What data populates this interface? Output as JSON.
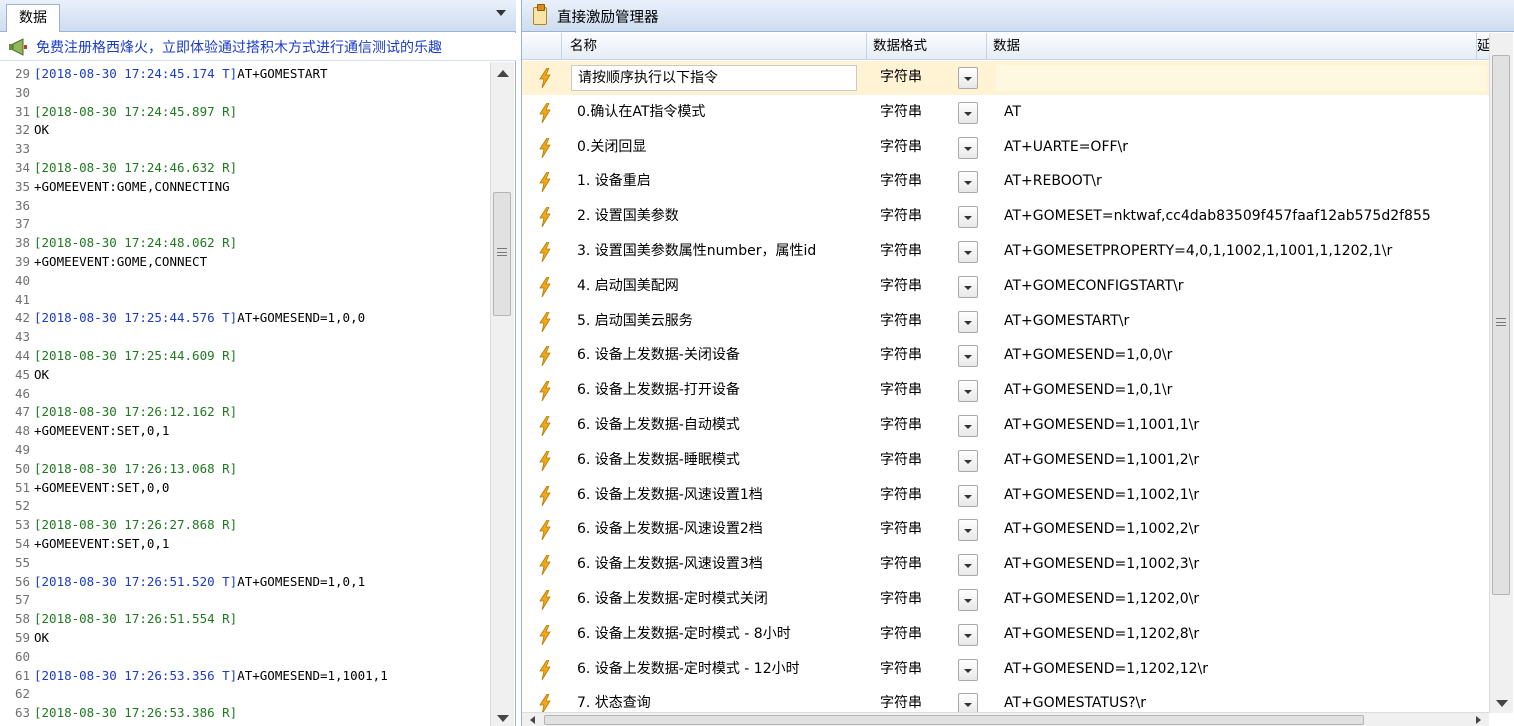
{
  "left": {
    "tab_label": "数据",
    "banner_text": "免费注册格西烽火，立即体验通过搭积木方式进行通信测试的乐趣",
    "log": [
      {
        "n": "29",
        "ts": "[2018-08-30 17:24:45.174 T]",
        "dir": "t",
        "text": "AT+GOMESTART"
      },
      {
        "n": "30",
        "ts": "",
        "dir": "",
        "text": ""
      },
      {
        "n": "31",
        "ts": "[2018-08-30 17:24:45.897 R]",
        "dir": "r",
        "text": ""
      },
      {
        "n": "32",
        "ts": "",
        "dir": "",
        "text": "OK"
      },
      {
        "n": "33",
        "ts": "",
        "dir": "",
        "text": ""
      },
      {
        "n": "34",
        "ts": "[2018-08-30 17:24:46.632 R]",
        "dir": "r",
        "text": ""
      },
      {
        "n": "35",
        "ts": "",
        "dir": "",
        "text": "+GOMEEVENT:GOME,CONNECTING"
      },
      {
        "n": "36",
        "ts": "",
        "dir": "",
        "text": ""
      },
      {
        "n": "37",
        "ts": "",
        "dir": "",
        "text": ""
      },
      {
        "n": "38",
        "ts": "[2018-08-30 17:24:48.062 R]",
        "dir": "r",
        "text": ""
      },
      {
        "n": "39",
        "ts": "",
        "dir": "",
        "text": "+GOMEEVENT:GOME,CONNECT"
      },
      {
        "n": "40",
        "ts": "",
        "dir": "",
        "text": ""
      },
      {
        "n": "41",
        "ts": "",
        "dir": "",
        "text": ""
      },
      {
        "n": "42",
        "ts": "[2018-08-30 17:25:44.576 T]",
        "dir": "t",
        "text": "AT+GOMESEND=1,0,0"
      },
      {
        "n": "43",
        "ts": "",
        "dir": "",
        "text": ""
      },
      {
        "n": "44",
        "ts": "[2018-08-30 17:25:44.609 R]",
        "dir": "r",
        "text": ""
      },
      {
        "n": "45",
        "ts": "",
        "dir": "",
        "text": "OK"
      },
      {
        "n": "46",
        "ts": "",
        "dir": "",
        "text": ""
      },
      {
        "n": "47",
        "ts": "[2018-08-30 17:26:12.162 R]",
        "dir": "r",
        "text": ""
      },
      {
        "n": "48",
        "ts": "",
        "dir": "",
        "text": "+GOMEEVENT:SET,0,1"
      },
      {
        "n": "49",
        "ts": "",
        "dir": "",
        "text": ""
      },
      {
        "n": "50",
        "ts": "[2018-08-30 17:26:13.068 R]",
        "dir": "r",
        "text": ""
      },
      {
        "n": "51",
        "ts": "",
        "dir": "",
        "text": "+GOMEEVENT:SET,0,0"
      },
      {
        "n": "52",
        "ts": "",
        "dir": "",
        "text": ""
      },
      {
        "n": "53",
        "ts": "[2018-08-30 17:26:27.868 R]",
        "dir": "r",
        "text": ""
      },
      {
        "n": "54",
        "ts": "",
        "dir": "",
        "text": "+GOMEEVENT:SET,0,1"
      },
      {
        "n": "55",
        "ts": "",
        "dir": "",
        "text": ""
      },
      {
        "n": "56",
        "ts": "[2018-08-30 17:26:51.520 T]",
        "dir": "t",
        "text": "AT+GOMESEND=1,0,1"
      },
      {
        "n": "57",
        "ts": "",
        "dir": "",
        "text": ""
      },
      {
        "n": "58",
        "ts": "[2018-08-30 17:26:51.554 R]",
        "dir": "r",
        "text": ""
      },
      {
        "n": "59",
        "ts": "",
        "dir": "",
        "text": "OK"
      },
      {
        "n": "60",
        "ts": "",
        "dir": "",
        "text": ""
      },
      {
        "n": "61",
        "ts": "[2018-08-30 17:26:53.356 T]",
        "dir": "t",
        "text": "AT+GOMESEND=1,1001,1"
      },
      {
        "n": "62",
        "ts": "",
        "dir": "",
        "text": ""
      },
      {
        "n": "63",
        "ts": "[2018-08-30 17:26:53.386 R]",
        "dir": "r",
        "text": ""
      }
    ]
  },
  "right": {
    "title": "直接激励管理器",
    "columns": {
      "name": "名称",
      "format": "数据格式",
      "data": "数据",
      "extra": "延"
    },
    "rows": [
      {
        "name": "请按顺序执行以下指令",
        "format": "字符串",
        "data": "",
        "selected": true
      },
      {
        "name": "0.确认在AT指令模式",
        "format": "字符串",
        "data": "AT"
      },
      {
        "name": "0.关闭回显",
        "format": "字符串",
        "data": "AT+UARTE=OFF\\r"
      },
      {
        "name": "1. 设备重启",
        "format": "字符串",
        "data": "AT+REBOOT\\r"
      },
      {
        "name": "2. 设置国美参数",
        "format": "字符串",
        "data": "AT+GOMESET=nktwaf,cc4dab83509f457faaf12ab575d2f855"
      },
      {
        "name": "3. 设置国美参数属性number，属性id",
        "format": "字符串",
        "data": "AT+GOMESETPROPERTY=4,0,1,1002,1,1001,1,1202,1\\r"
      },
      {
        "name": "4. 启动国美配网",
        "format": "字符串",
        "data": "AT+GOMECONFIGSTART\\r"
      },
      {
        "name": "5. 启动国美云服务",
        "format": "字符串",
        "data": "AT+GOMESTART\\r"
      },
      {
        "name": "6. 设备上发数据-关闭设备",
        "format": "字符串",
        "data": "AT+GOMESEND=1,0,0\\r"
      },
      {
        "name": "6. 设备上发数据-打开设备",
        "format": "字符串",
        "data": "AT+GOMESEND=1,0,1\\r"
      },
      {
        "name": "6. 设备上发数据-自动模式",
        "format": "字符串",
        "data": "AT+GOMESEND=1,1001,1\\r"
      },
      {
        "name": "6. 设备上发数据-睡眠模式",
        "format": "字符串",
        "data": "AT+GOMESEND=1,1001,2\\r"
      },
      {
        "name": "6. 设备上发数据-风速设置1档",
        "format": "字符串",
        "data": "AT+GOMESEND=1,1002,1\\r"
      },
      {
        "name": "6. 设备上发数据-风速设置2档",
        "format": "字符串",
        "data": "AT+GOMESEND=1,1002,2\\r"
      },
      {
        "name": "6. 设备上发数据-风速设置3档",
        "format": "字符串",
        "data": "AT+GOMESEND=1,1002,3\\r"
      },
      {
        "name": "6. 设备上发数据-定时模式关闭",
        "format": "字符串",
        "data": "AT+GOMESEND=1,1202,0\\r"
      },
      {
        "name": "6. 设备上发数据-定时模式 - 8小时",
        "format": "字符串",
        "data": "AT+GOMESEND=1,1202,8\\r"
      },
      {
        "name": "6. 设备上发数据-定时模式 - 12小时",
        "format": "字符串",
        "data": "AT+GOMESEND=1,1202,12\\r"
      },
      {
        "name": "7. 状态查询",
        "format": "字符串",
        "data": "AT+GOMESTATUS?\\r"
      }
    ]
  },
  "icons": {
    "row_icon": "lightning-bolt-icon",
    "title_icon": "clipboard-icon",
    "banner_icon": "megaphone-icon"
  },
  "colors": {
    "ts_transmit": "#1a3cc8",
    "ts_receive": "#1f7a1f",
    "banner_link": "#1a3cc8",
    "bolt": "#f0a818",
    "selected_row": "#fff3d4"
  }
}
